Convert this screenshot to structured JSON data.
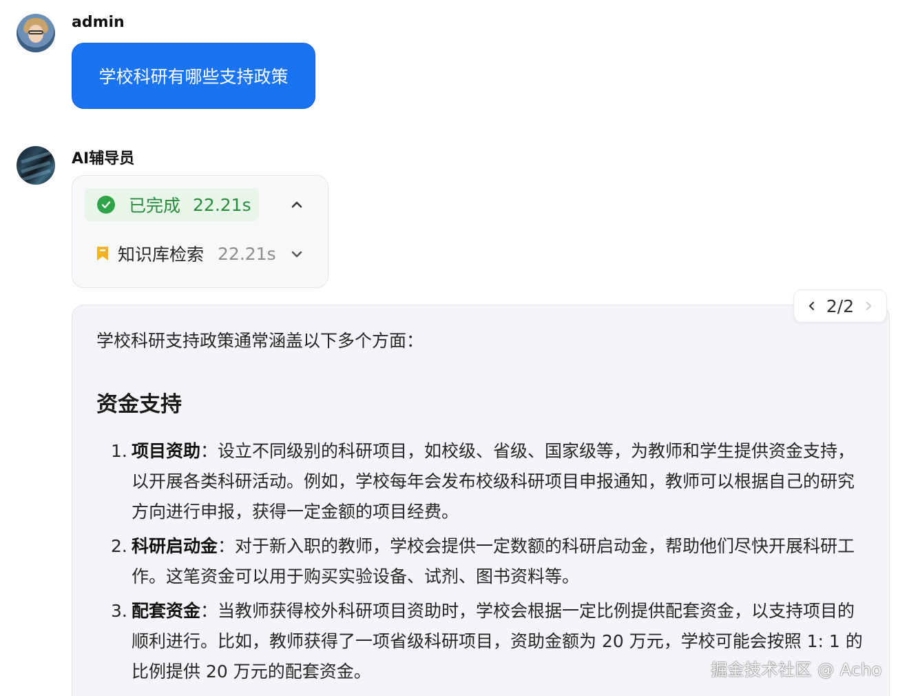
{
  "user_message": {
    "author": "admin",
    "text": "学校科研有哪些支持政策"
  },
  "bot_message": {
    "author": "AI辅导员",
    "status": {
      "label": "已完成",
      "time": "22.21s"
    },
    "steps": [
      {
        "label": "知识库检索",
        "time": "22.21s"
      }
    ],
    "pager": {
      "text": "2/2"
    },
    "answer": {
      "intro": "学校科研支持政策通常涵盖以下多个方面：",
      "heading": "资金支持",
      "items": [
        {
          "num": "1.",
          "title": "项目资助",
          "text": "：设立不同级别的科研项目，如校级、省级、国家级等，为教师和学生提供资金支持，以开展各类科研活动。例如，学校每年会发布校级科研项目申报通知，教师可以根据自己的研究方向进行申报，获得一定金额的项目经费。"
        },
        {
          "num": "2.",
          "title": "科研启动金",
          "text": "：对于新入职的教师，学校会提供一定数额的科研启动金，帮助他们尽快开展科研工作。这笔资金可以用于购买实验设备、试剂、图书资料等。"
        },
        {
          "num": "3.",
          "title": "配套资金",
          "text": "：当教师获得校外科研项目资助时，学校会根据一定比例提供配套资金，以支持项目的顺利进行。比如，教师获得了一项省级科研项目，资助金额为 20 万元，学校可能会按照 1: 1 的比例提供 20 万元的配套资金。"
        }
      ]
    }
  },
  "watermark": "掘金技术社区 @ Acho",
  "colors": {
    "primary": "#1a73f0",
    "success": "#2fa347",
    "bookmark": "#f5b224"
  },
  "icons": [
    "check-circle-icon",
    "chevron-up-icon",
    "bookmark-icon",
    "chevron-down-icon",
    "chevron-left-icon",
    "chevron-right-icon"
  ]
}
